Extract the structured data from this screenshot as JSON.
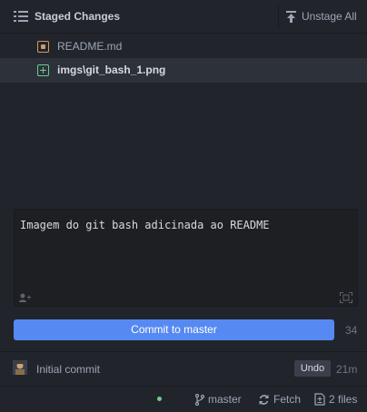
{
  "header": {
    "title": "Staged Changes",
    "unstage_all_label": "Unstage All"
  },
  "staged_files": [
    {
      "name": "README.md",
      "status": "modified",
      "status_color": "#d19a66"
    },
    {
      "name": "imgs\\git_bash_1.png",
      "status": "added",
      "status_color": "#73c990"
    }
  ],
  "editor": {
    "message": "Imagem do git bash adicinada ao README"
  },
  "commit": {
    "button_label": "Commit to master",
    "char_count": "34",
    "accent_color": "#568af2"
  },
  "recent_commit": {
    "message": "Initial commit",
    "undo_label": "Undo",
    "time": "21m"
  },
  "status_bar": {
    "branch": "master",
    "fetch_label": "Fetch",
    "files_label": "2 files"
  }
}
